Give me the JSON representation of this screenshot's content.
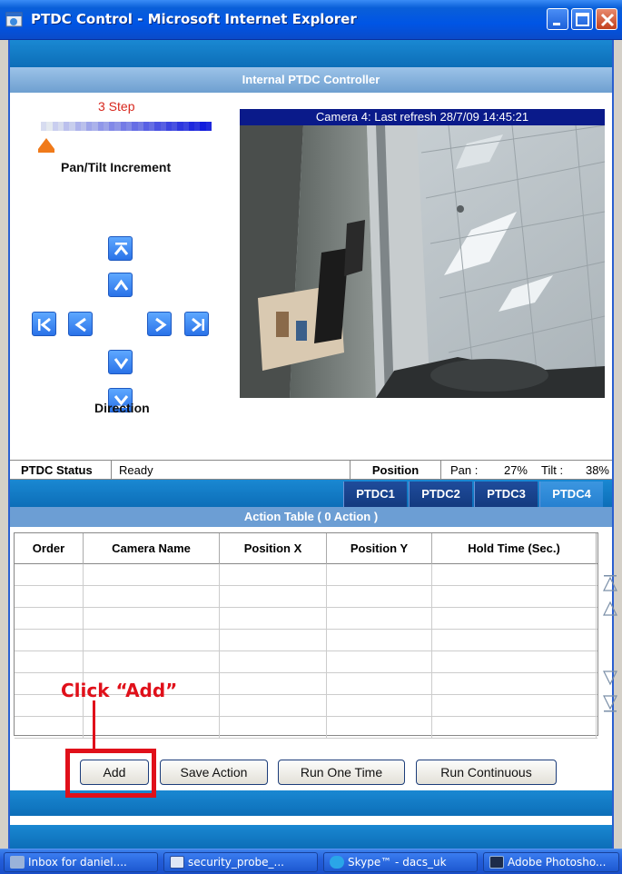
{
  "window": {
    "title": "PTDC Control - Microsoft Internet Explorer",
    "buttons": [
      "minimize",
      "maximize",
      "close"
    ]
  },
  "header": {
    "title": "Internal PTDC Controller"
  },
  "ptz": {
    "step_label": "3 Step",
    "step_level_fraction": 0.0,
    "increment_label": "Pan/Tilt Increment",
    "direction_label": "Direction",
    "buttons": [
      "up-top",
      "up",
      "left-far",
      "left",
      "right",
      "right-far",
      "down",
      "down-bottom"
    ]
  },
  "camera": {
    "header": "Camera 4: Last refresh 28/7/09 14:45:21"
  },
  "status": {
    "label": "PTDC Status",
    "value": "Ready",
    "position_label": "Position",
    "pan_label": "Pan :",
    "pan_value": "27%",
    "tilt_label": "Tilt :",
    "tilt_value": "38%"
  },
  "tabs": [
    {
      "label": "PTDC1",
      "active": false
    },
    {
      "label": "PTDC2",
      "active": false
    },
    {
      "label": "PTDC3",
      "active": false
    },
    {
      "label": "PTDC4",
      "active": true
    }
  ],
  "action_table": {
    "title": "Action Table  ( 0 Action )",
    "columns": [
      "Order",
      "Camera Name",
      "Position X",
      "Position Y",
      "Hold Time (Sec.)"
    ],
    "rows": [
      [],
      [],
      [],
      [],
      [],
      [],
      [],
      []
    ]
  },
  "buttons": {
    "add": "Add",
    "save_action": "Save Action",
    "run_one_time": "Run One Time",
    "run_continuous": "Run Continuous"
  },
  "annotation": {
    "text": "Click “Add”"
  },
  "taskbar": {
    "items": [
      {
        "label": "Inbox for daniel....",
        "icon": "mail-icon"
      },
      {
        "label": "security_probe_...",
        "icon": "word-doc-icon"
      },
      {
        "label": "Skype™ - dacs_uk",
        "icon": "skype-icon"
      },
      {
        "label": "Adobe Photosho...",
        "icon": "photoshop-icon"
      }
    ]
  },
  "colors": {
    "accent": "#0c6eb8",
    "title_bar": "#0055e5",
    "annotation": "#e0101a",
    "camera_header": "#0a1a8a"
  }
}
